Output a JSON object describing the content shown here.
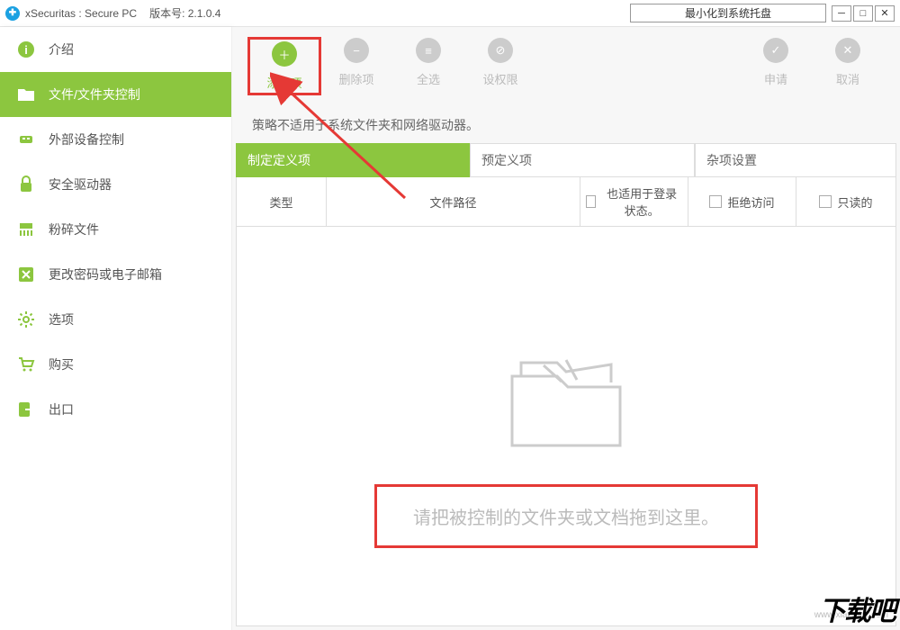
{
  "title": {
    "app": "xSecuritas : Secure PC",
    "version_label": "版本号:",
    "version": "2.1.0.4",
    "tray": "最小化到系统托盘"
  },
  "sidebar": {
    "items": [
      {
        "label": "介绍"
      },
      {
        "label": "文件/文件夹控制"
      },
      {
        "label": "外部设备控制"
      },
      {
        "label": "安全驱动器"
      },
      {
        "label": "粉碎文件"
      },
      {
        "label": "更改密码或电子邮箱"
      },
      {
        "label": "选项"
      },
      {
        "label": "购买"
      },
      {
        "label": "出口"
      }
    ]
  },
  "toolbar": {
    "add": "添加项",
    "remove": "删除项",
    "select_all": "全选",
    "permissions": "设权限",
    "apply": "申请",
    "cancel": "取消"
  },
  "description": "策略不适用于系统文件夹和网络驱动器。",
  "tabs": {
    "custom": "制定定义项",
    "preset": "预定义项",
    "misc": "杂项设置"
  },
  "columns": {
    "type": "类型",
    "path": "文件路径",
    "login": "也适用于登录状态。",
    "deny": "拒绝访问",
    "readonly": "只读的"
  },
  "drop_message": "请把被控制的文件夹或文档拖到这里。",
  "watermark": "www.xiazaiba.com",
  "brand": "下载吧"
}
